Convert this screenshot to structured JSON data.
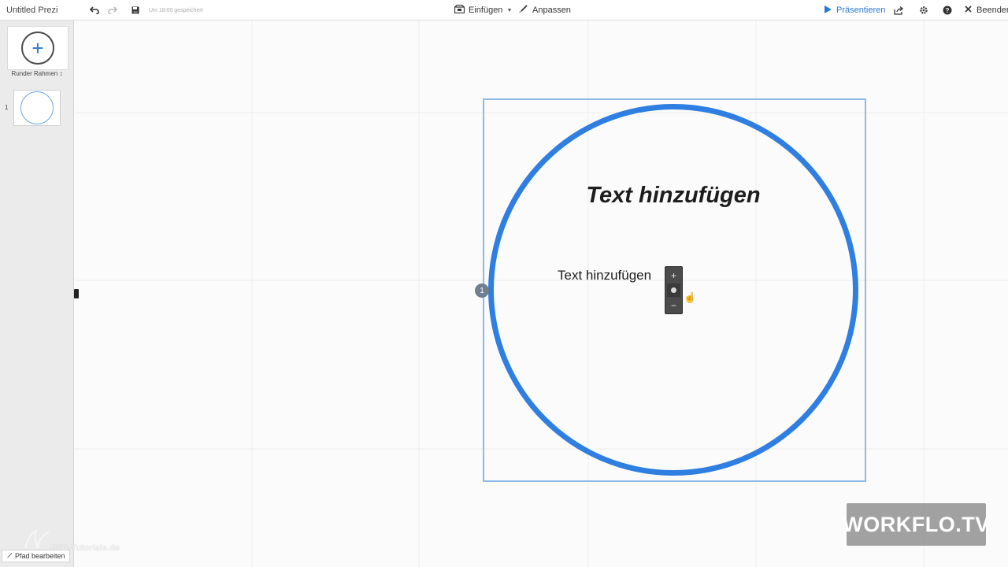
{
  "app": {
    "title": "Untitled Prezi",
    "saved_status": "Um 18:00 gespeichert"
  },
  "toolbar": {
    "insert_label": "Einfügen",
    "customize_label": "Anpassen",
    "present_label": "Präsentieren",
    "close_label": "Beenden",
    "icons": [
      "undo-icon",
      "redo-icon",
      "save-icon",
      "insert-icon",
      "brush-icon",
      "play-icon",
      "share-icon",
      "gear-icon",
      "help-icon",
      "close-icon"
    ]
  },
  "sidebar": {
    "frame_type_label": "Runder Rahmen",
    "slides": [
      {
        "number": "1"
      }
    ],
    "edit_path_label": "Pfad bearbeiten"
  },
  "canvas": {
    "headline_text": "Text hinzufügen",
    "body_text": "Text hinzufügen",
    "path_badge": "1",
    "frame_color": "#2f7fe2",
    "selection_color": "#8dbbe6",
    "zoom_controls": {
      "zoom_in": "+",
      "zoom_out": "−"
    }
  },
  "watermarks": {
    "workflo": "WORKFLO.TV",
    "psd": "PSD-Tutorials.de"
  }
}
